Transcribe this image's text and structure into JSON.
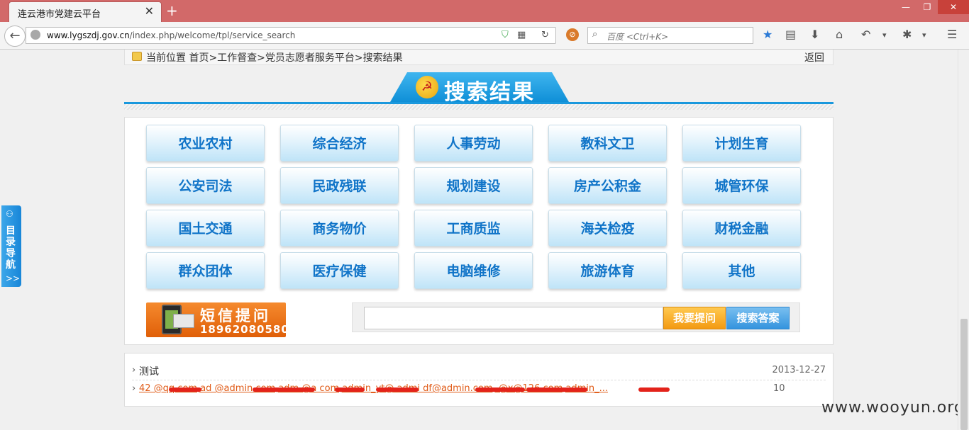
{
  "browser": {
    "tab_title": "连云港市党建云平台",
    "tab_close": "✕",
    "new_tab": "+",
    "url_host": "www.lygszdj.gov.cn",
    "url_path": "/index.php/welcome/tpl/service_search",
    "search_placeholder": "百度 <Ctrl+K>",
    "icons": [
      "back-icon",
      "globe-icon",
      "shield-icon",
      "qr-icon",
      "reload-icon",
      "block-icon",
      "search-icon",
      "star-icon",
      "reading-list-icon",
      "download-icon",
      "home-icon",
      "undo-icon",
      "chevron-down-icon",
      "gesture-icon",
      "menu-icon"
    ]
  },
  "breadcrumb": {
    "text": "当前位置 首页>工作督查>党员志愿者服务平台>搜索结果",
    "back": "返回"
  },
  "section_title": "搜索结果",
  "categories": [
    "农业农村",
    "综合经济",
    "人事劳动",
    "教科文卫",
    "计划生育",
    "公安司法",
    "民政残联",
    "规划建设",
    "房产公积金",
    "城管环保",
    "国土交通",
    "商务物价",
    "工商质监",
    "海关检疫",
    "财税金融",
    "群众团体",
    "医疗保健",
    "电脑维修",
    "旅游体育",
    "其他"
  ],
  "sms": {
    "title": "短信提问",
    "phone": "18962080580"
  },
  "search": {
    "value": "",
    "ask_label": "我要提问",
    "find_label": "搜索答案"
  },
  "results": [
    {
      "title": "测试",
      "meta": "2013-12-27"
    },
    {
      "title": "42        @qq.com,ad         @admin.com,adm     @a         com,admin_yt@         admi  df@admin.com,    @x@126.com,admin_...",
      "meta": "10"
    }
  ],
  "side_nav": {
    "label": "目录导航",
    "arrows": ">>"
  },
  "watermark": "www.wooyun.org",
  "colors": {
    "titlebar": "#d26969",
    "accent_blue": "#1a98dd",
    "category_text": "#1074c8",
    "link_orange": "#e05a16",
    "sms_orange": "#e05f08"
  }
}
